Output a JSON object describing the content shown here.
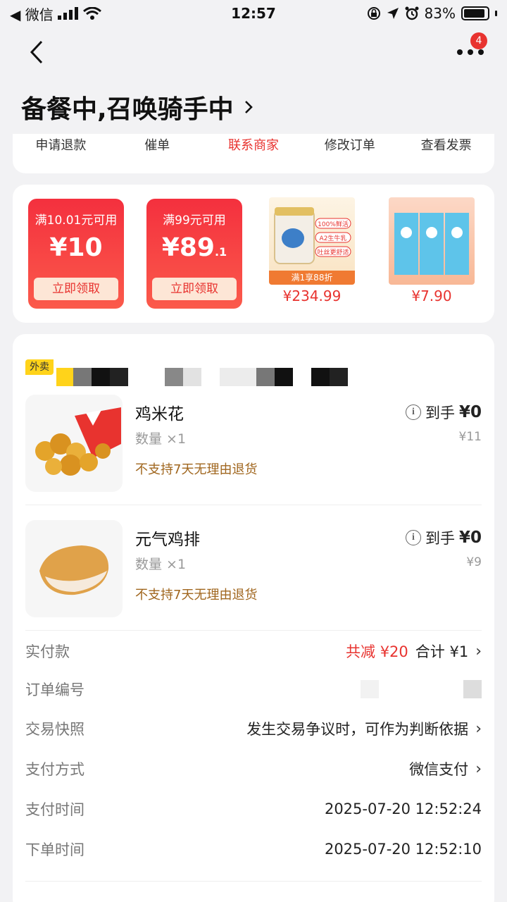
{
  "status_bar": {
    "back_app": "◀ 微信",
    "time": "12:57",
    "battery": "83%"
  },
  "nav": {
    "badge_count": "4"
  },
  "order": {
    "status_title": "备餐中,召唤骑手中"
  },
  "actions": [
    {
      "label": "申请退款"
    },
    {
      "label": "催单"
    },
    {
      "label": "联系商家"
    },
    {
      "label": "修改订单"
    },
    {
      "label": "查看发票"
    }
  ],
  "promos": {
    "coupons": [
      {
        "condition": "满10.01元可用",
        "amount": "¥10",
        "amount_small": "",
        "button": "立即领取"
      },
      {
        "condition": "满99元可用",
        "amount": "¥89",
        "amount_small": ".1",
        "button": "立即领取"
      }
    ],
    "products": [
      {
        "price": "¥234.99",
        "tags": [
          "100%鲜活",
          "A2生牛乳",
          "吐丝更舒适"
        ],
        "banner": "满1享88折"
      },
      {
        "price": "¥7.90"
      }
    ]
  },
  "shop": {
    "tag": "外卖"
  },
  "items": [
    {
      "name": "鸡米花",
      "qty": "数量 ×1",
      "note": "不支持7天无理由退货",
      "net_label": "到手",
      "net_value": "¥0",
      "price": "¥11"
    },
    {
      "name": "元气鸡排",
      "qty": "数量 ×1",
      "note": "不支持7天无理由退货",
      "net_label": "到手",
      "net_value": "¥0",
      "price": "¥9"
    }
  ],
  "details": {
    "paid": {
      "label": "实付款",
      "discount": "共减 ¥20",
      "total": "合计 ¥1"
    },
    "order_no": {
      "label": "订单编号"
    },
    "snapshot": {
      "label": "交易快照",
      "value": "发生交易争议时，可作为判断依据"
    },
    "pay_method": {
      "label": "支付方式",
      "value": "微信支付"
    },
    "pay_time": {
      "label": "支付时间",
      "value": "2025-07-20 12:52:24"
    },
    "order_time": {
      "label": "下单时间",
      "value": "2025-07-20 12:52:10"
    }
  },
  "colors": {
    "accent": "#e8332f",
    "note": "#a0661e",
    "coupon_start": "#f4303e",
    "coupon_end": "#fb5a4b"
  }
}
